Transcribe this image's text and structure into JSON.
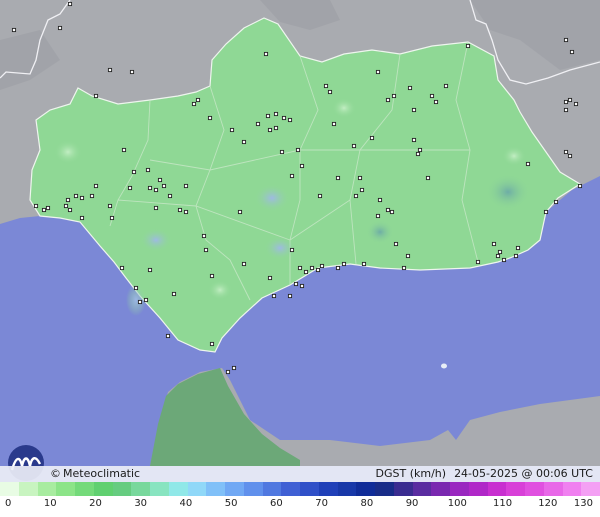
{
  "brand": {
    "symbol": "©",
    "name": "Meteoclimatic"
  },
  "info": {
    "variable": "DGST (km/h)",
    "timestamp": "24-05-2025 @ 00:06 UTC"
  },
  "legend": {
    "labels": [
      "0",
      "10",
      "20",
      "30",
      "40",
      "50",
      "60",
      "70",
      "80",
      "90",
      "100",
      "110",
      "120",
      "130"
    ],
    "colors": [
      "#e8fce4",
      "#c8f4c0",
      "#a8eca0",
      "#8ce488",
      "#74da7a",
      "#60d070",
      "#66cc80",
      "#78d89c",
      "#88e4c0",
      "#90e8e8",
      "#90d8f8",
      "#80c0f8",
      "#70a8f4",
      "#6090ec",
      "#5078e0",
      "#4060d4",
      "#3050c8",
      "#2040b8",
      "#1838a8",
      "#102c98",
      "#182c88",
      "#3a2c90",
      "#5a2ca0",
      "#7a28b0",
      "#9a28c0",
      "#b028c8",
      "#c830d0",
      "#d840d8",
      "#e050e0",
      "#e868e8",
      "#f080f0",
      "#f4a0f4"
    ]
  },
  "colors": {
    "sea": "#7b88d6",
    "land": "#a9abb0",
    "region": "#8fd895",
    "morocco": "#6ca878"
  },
  "icons": {
    "logo": "meteoclimatic-wave-logo"
  }
}
